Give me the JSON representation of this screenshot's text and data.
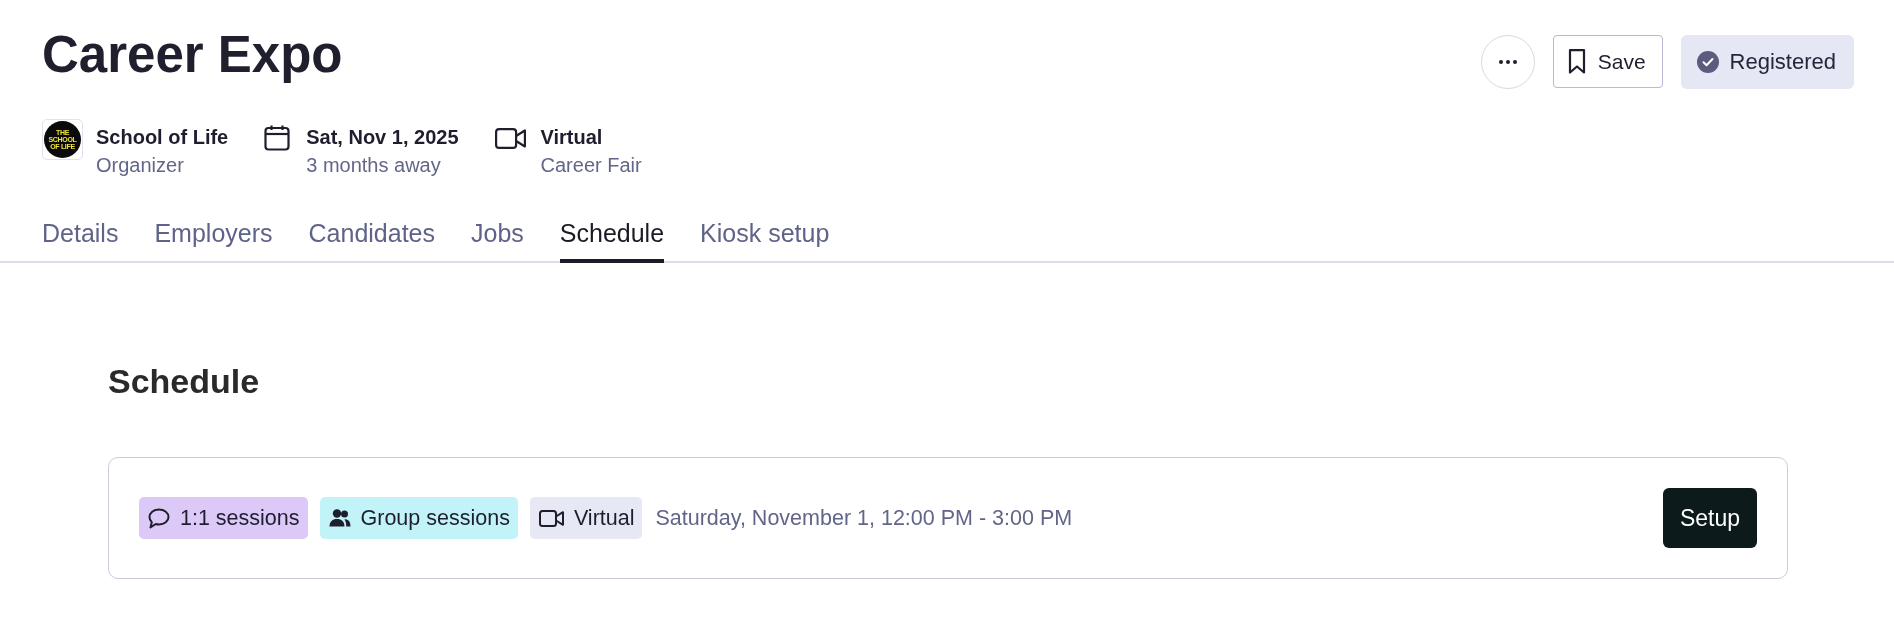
{
  "header": {
    "title": "Career Expo",
    "actions": [
      {
        "kind": "more"
      },
      {
        "kind": "save",
        "label": "Save"
      },
      {
        "kind": "registered",
        "label": "Registered"
      }
    ],
    "meta": [
      {
        "kind": "organizer",
        "logo_text": "THE SCHOOL OF LIFE",
        "primary": "School of Life",
        "secondary": "Organizer"
      },
      {
        "kind": "date",
        "primary": "Sat, Nov 1, 2025",
        "secondary": "3 months away"
      },
      {
        "kind": "virtual",
        "primary": "Virtual",
        "secondary": "Career Fair"
      }
    ]
  },
  "tabs": [
    {
      "label": "Details",
      "selected": false
    },
    {
      "label": "Employers",
      "selected": false
    },
    {
      "label": "Candidates",
      "selected": false
    },
    {
      "label": "Jobs",
      "selected": false
    },
    {
      "label": "Schedule",
      "selected": true
    },
    {
      "label": "Kiosk setup",
      "selected": false
    }
  ],
  "schedule": {
    "heading": "Schedule",
    "sessions": [
      {
        "kind": "one_on_one",
        "label": "1:1 sessions",
        "color": "#dcc9f8"
      },
      {
        "kind": "group",
        "label": "Group sessions",
        "color": "#c2f3f9"
      },
      {
        "kind": "virtual",
        "label": "Virtual",
        "color": "#e6e8f4"
      }
    ],
    "time": "Saturday, November 1, 12:00 PM - 3:00 PM",
    "button": "Setup"
  }
}
